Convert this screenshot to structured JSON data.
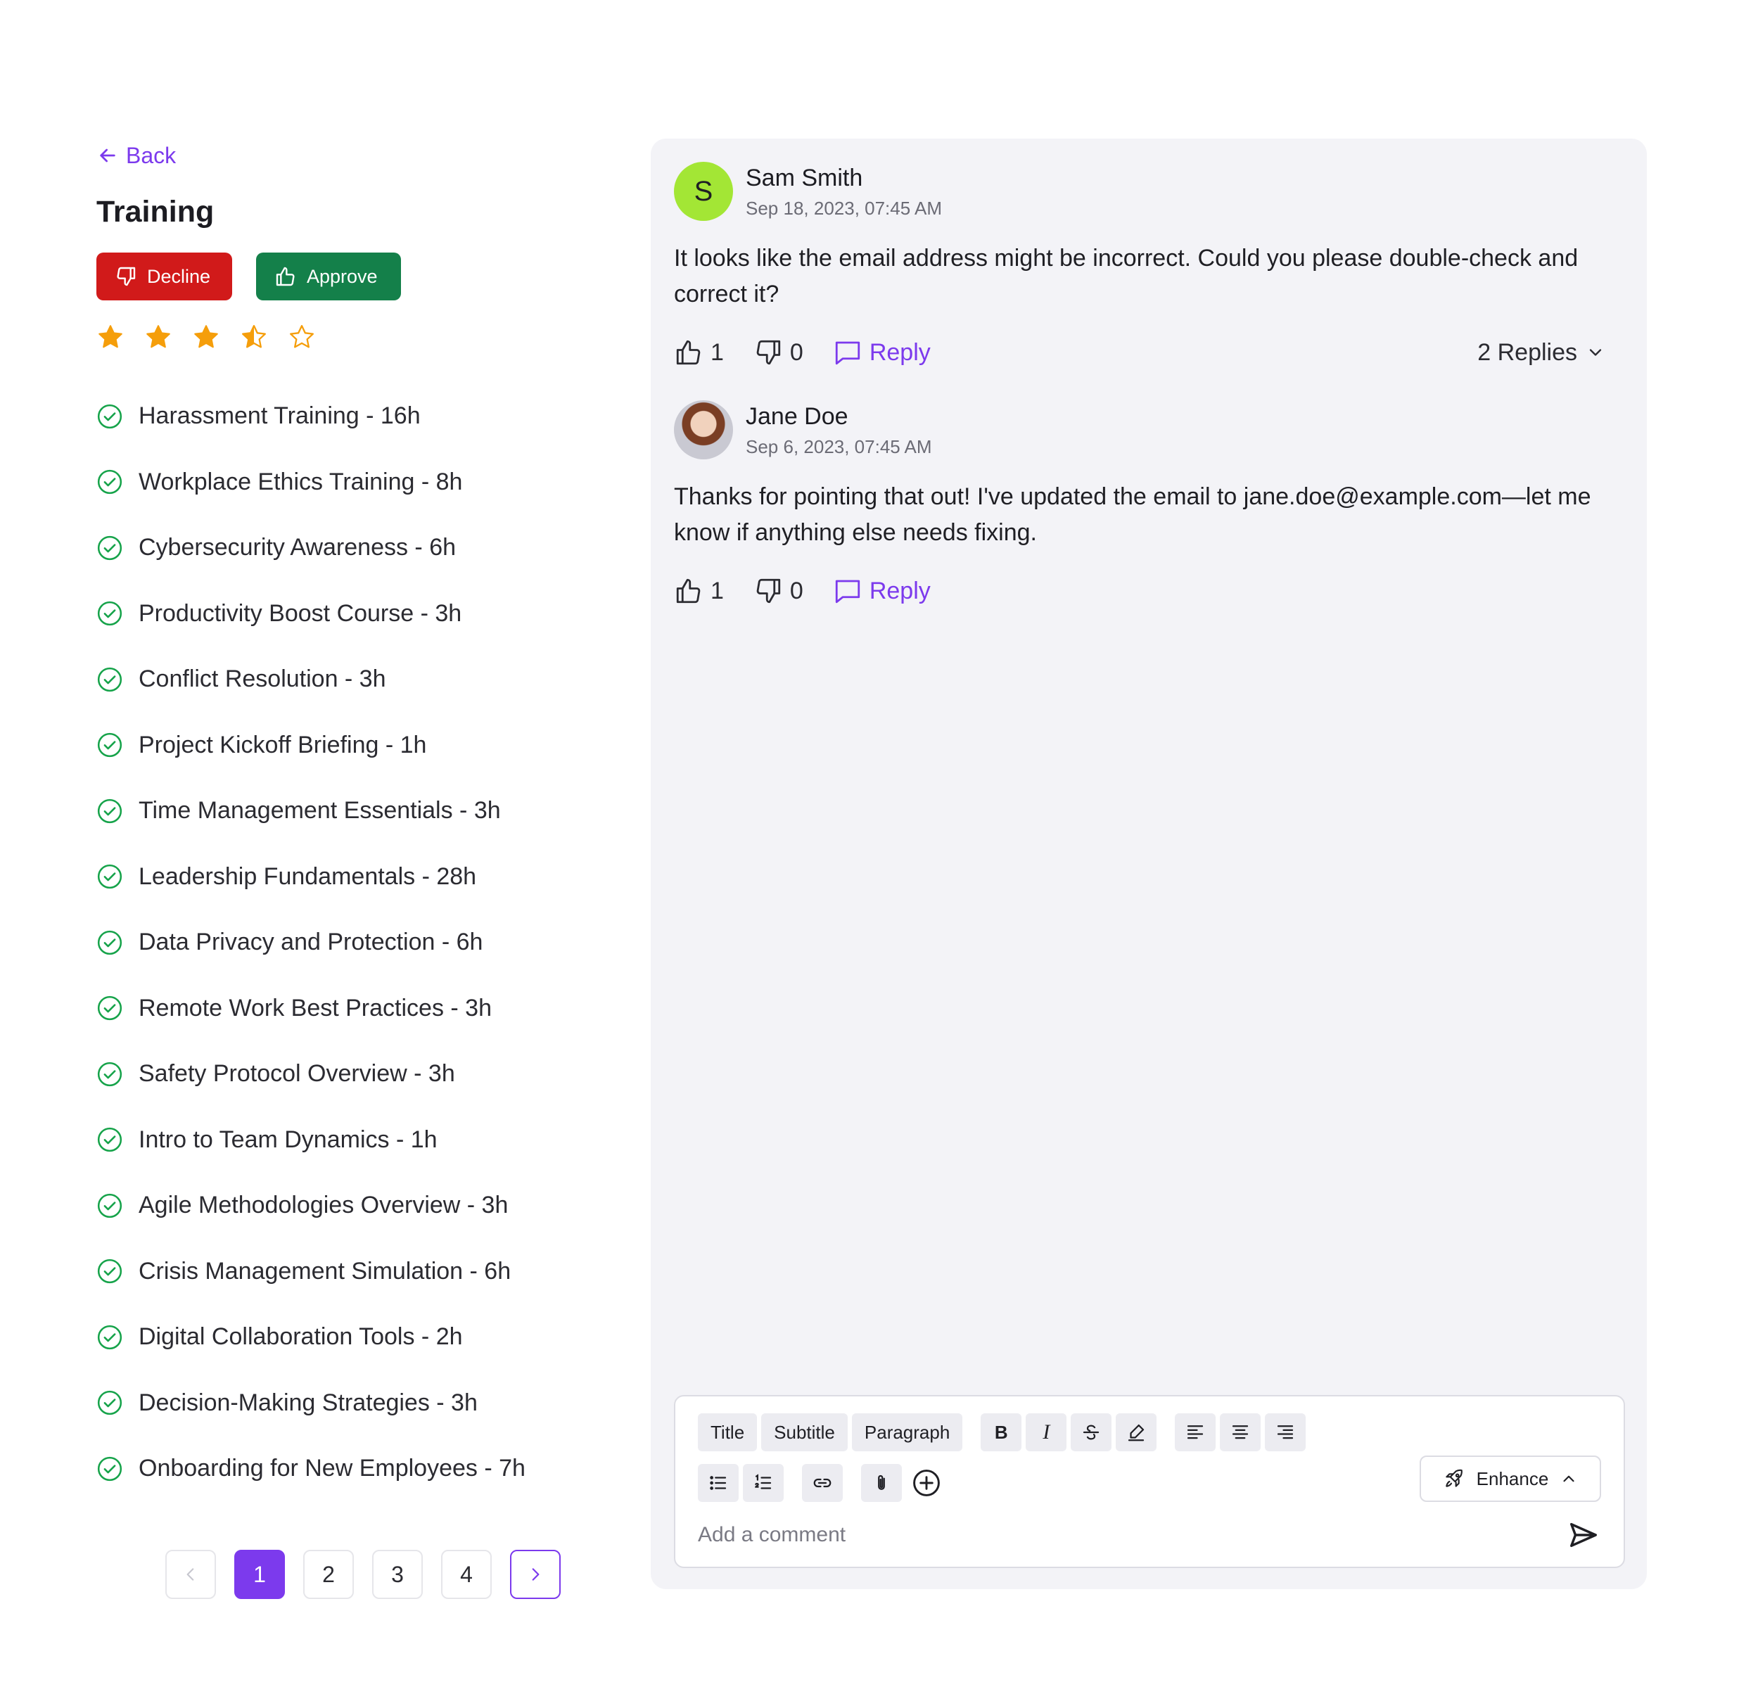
{
  "header": {
    "back_label": "Back",
    "title": "Training"
  },
  "actions": {
    "decline_label": "Decline",
    "approve_label": "Approve"
  },
  "rating": {
    "value": 3.5,
    "max": 5
  },
  "colors": {
    "accent": "#7c3aed",
    "decline": "#d11a1a",
    "approve": "#14804a",
    "star": "#f59e0b",
    "check": "#16a34a"
  },
  "trainings": [
    "Harassment Training - 16h",
    "Workplace Ethics Training -  8h",
    "Cybersecurity Awareness -  6h",
    "Productivity Boost Course - 3h",
    "Conflict Resolution -  3h",
    "Project Kickoff Briefing -  1h",
    "Time Management Essentials - 3h",
    "Leadership Fundamentals -  28h",
    "Data Privacy and Protection -  6h",
    "Remote Work Best Practices - 3h",
    "Safety Protocol Overview -  3h",
    "Intro to Team Dynamics -  1h",
    "Agile Methodologies Overview -  3h",
    "Crisis Management Simulation -  6h",
    "Digital Collaboration Tools - 2h",
    "Decision-Making Strategies -  3h",
    "Onboarding for New Employees -  7h"
  ],
  "pagination": {
    "pages": [
      "1",
      "2",
      "3",
      "4"
    ],
    "current": "1"
  },
  "comments": [
    {
      "avatar_initial": "S",
      "author": "Sam Smith",
      "date": "Sep 18, 2023, 07:45 AM",
      "body": "It looks like the email address might be incorrect. Could you please double-check and correct it?",
      "likes": "1",
      "dislikes": "0",
      "reply_label": "Reply",
      "replies_label": "2 Replies"
    },
    {
      "author": "Jane Doe",
      "date": "Sep 6, 2023, 07:45 AM",
      "body": "Thanks for pointing that out! I've updated the email to jane.doe@example.com—let me know if anything else needs fixing.",
      "likes": "1",
      "dislikes": "0",
      "reply_label": "Reply"
    }
  ],
  "editor": {
    "title_label": "Title",
    "subtitle_label": "Subtitle",
    "paragraph_label": "Paragraph",
    "bold_label": "B",
    "italic_label": "I",
    "enhance_label": "Enhance",
    "placeholder": "Add a comment"
  }
}
